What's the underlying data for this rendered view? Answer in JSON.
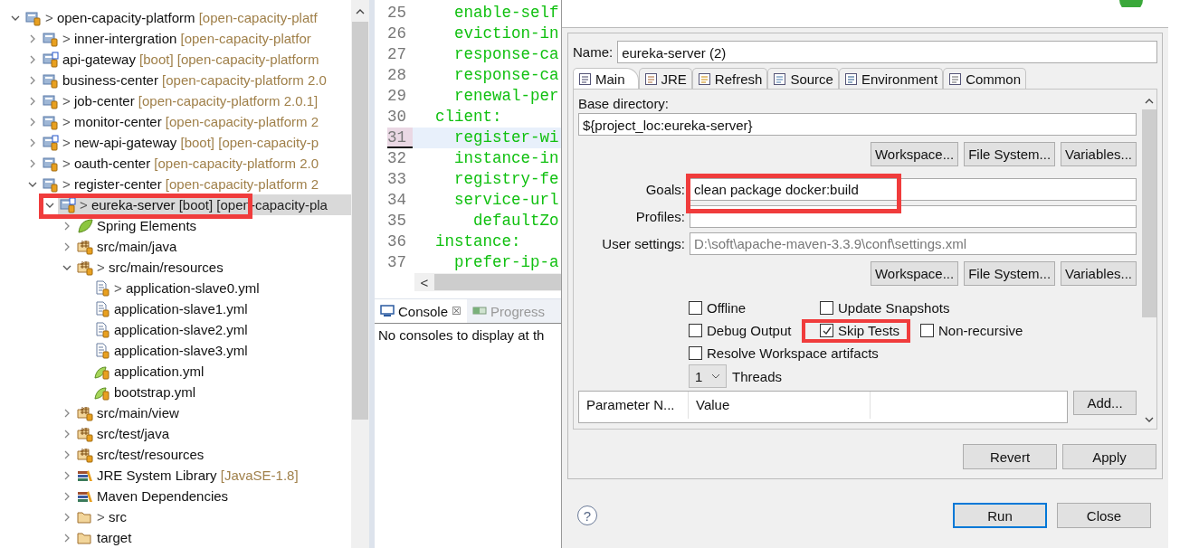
{
  "tree": {
    "items": [
      {
        "label": "open-capacity-platform",
        "prefix": ">",
        "detail": "[open-capacity-platf",
        "kind": "project",
        "expanded": true,
        "selected": false,
        "children": [
          {
            "label": "inner-intergration",
            "prefix": ">",
            "detail": "[open-capacity-platfor",
            "kind": "project",
            "expanded": false,
            "selected": false
          },
          {
            "label": "api-gateway",
            "detail": "[boot] [open-capacity-platform",
            "kind": "boot-project",
            "expanded": false,
            "selected": false
          },
          {
            "label": "business-center",
            "detail": "[open-capacity-platform 2.0",
            "kind": "project",
            "expanded": false,
            "selected": false
          },
          {
            "label": "job-center",
            "prefix": ">",
            "detail": "[open-capacity-platform 2.0.1]",
            "kind": "project",
            "expanded": false,
            "selected": false
          },
          {
            "label": "monitor-center",
            "prefix": ">",
            "detail": "[open-capacity-platform 2",
            "kind": "project",
            "expanded": false,
            "selected": false
          },
          {
            "label": "new-api-gateway",
            "prefix": ">",
            "detail": "[boot] [open-capacity-p",
            "kind": "boot-project",
            "expanded": false,
            "selected": false
          },
          {
            "label": "oauth-center",
            "prefix": ">",
            "detail": "[open-capacity-platform 2.0",
            "kind": "project",
            "expanded": false,
            "selected": false
          },
          {
            "label": "register-center",
            "prefix": ">",
            "detail": "[open-capacity-platform 2",
            "kind": "project",
            "expanded": true,
            "selected": false,
            "children": [
              {
                "label": "eureka-server",
                "prefix": ">",
                "detail": "[boot] [open-capacity-pla",
                "kind": "boot-project",
                "expanded": true,
                "selected": true,
                "children": [
                  {
                    "label": "Spring Elements",
                    "kind": "spring",
                    "expanded": false,
                    "selected": false
                  },
                  {
                    "label": "src/main/java",
                    "kind": "package-folder",
                    "expanded": false,
                    "selected": false
                  },
                  {
                    "label": "src/main/resources",
                    "prefix": ">",
                    "kind": "package-folder",
                    "expanded": true,
                    "selected": false,
                    "children": [
                      {
                        "label": "application-slave0.yml",
                        "prefix": ">",
                        "kind": "file",
                        "selected": false
                      },
                      {
                        "label": "application-slave1.yml",
                        "kind": "file",
                        "selected": false
                      },
                      {
                        "label": "application-slave2.yml",
                        "kind": "file",
                        "selected": false
                      },
                      {
                        "label": "application-slave3.yml",
                        "kind": "file",
                        "selected": false
                      },
                      {
                        "label": "application.yml",
                        "kind": "yml",
                        "selected": false
                      },
                      {
                        "label": "bootstrap.yml",
                        "kind": "yml",
                        "selected": false
                      }
                    ]
                  },
                  {
                    "label": "src/main/view",
                    "kind": "package-folder",
                    "expanded": false,
                    "selected": false
                  },
                  {
                    "label": "src/test/java",
                    "kind": "package-folder",
                    "expanded": false,
                    "selected": false
                  },
                  {
                    "label": "src/test/resources",
                    "kind": "package-folder",
                    "expanded": false,
                    "selected": false
                  },
                  {
                    "label": "JRE System Library",
                    "detail": "[JavaSE-1.8]",
                    "kind": "library",
                    "expanded": false,
                    "selected": false
                  },
                  {
                    "label": "Maven Dependencies",
                    "kind": "library",
                    "expanded": false,
                    "selected": false
                  },
                  {
                    "label": "src",
                    "prefix": ">",
                    "kind": "folder",
                    "expanded": false,
                    "selected": false
                  },
                  {
                    "label": "target",
                    "kind": "folder",
                    "expanded": false,
                    "selected": false
                  }
                ]
              }
            ]
          }
        ]
      }
    ]
  },
  "editor": {
    "lines": [
      {
        "number": "25",
        "code": "    enable-self",
        "current": false
      },
      {
        "number": "26",
        "code": "    eviction-in",
        "current": false
      },
      {
        "number": "27",
        "code": "    response-ca",
        "current": false
      },
      {
        "number": "28",
        "code": "    response-ca",
        "current": false
      },
      {
        "number": "29",
        "code": "    renewal-per",
        "current": false
      },
      {
        "number": "30",
        "code": "  client:",
        "current": false
      },
      {
        "number": "31",
        "code": "    register-wi",
        "current": true
      },
      {
        "number": "32",
        "code": "    instance-in",
        "current": false
      },
      {
        "number": "33",
        "code": "    registry-fe",
        "current": false
      },
      {
        "number": "34",
        "code": "    service-url",
        "current": false
      },
      {
        "number": "35",
        "code": "      defaultZo",
        "current": false
      },
      {
        "number": "36",
        "code": "  instance:",
        "current": false
      },
      {
        "number": "37",
        "code": "    prefer-ip-a",
        "current": false
      }
    ],
    "scroll_left": "<"
  },
  "console": {
    "tabs": [
      {
        "label": "Console",
        "close": "☒",
        "selected": true
      },
      {
        "label": "Progress",
        "selected": false
      }
    ],
    "message": "No consoles to display at th"
  },
  "dialog": {
    "name_label": "Name:",
    "name": "eureka-server (2)",
    "tabs": [
      {
        "label": "Main",
        "selected": true
      },
      {
        "label": "JRE",
        "selected": false
      },
      {
        "label": "Refresh",
        "selected": false
      },
      {
        "label": "Source",
        "selected": false
      },
      {
        "label": "Environment",
        "selected": false
      },
      {
        "label": "Common",
        "selected": false
      }
    ],
    "base_directory_label": "Base directory:",
    "base_directory": "${project_loc:eureka-server}",
    "dir_buttons": [
      "Workspace...",
      "File System...",
      "Variables..."
    ],
    "fields": [
      {
        "label": "Goals:",
        "value": "clean package docker:build"
      },
      {
        "label": "Profiles:"
      },
      {
        "label": "User settings:",
        "placeholder": "D:\\soft\\apache-maven-3.3.9\\conf\\settings.xml"
      }
    ],
    "settings_buttons": [
      "Workspace...",
      "File System...",
      "Variables..."
    ],
    "option_rows": [
      [
        {
          "label": "Offline",
          "checked": false
        },
        {
          "label": "Update Snapshots",
          "checked": false
        }
      ],
      [
        {
          "label": "Debug Output",
          "checked": false
        },
        {
          "label": "Skip Tests",
          "checked": true
        },
        {
          "label": "Non-recursive",
          "checked": false
        }
      ],
      [
        {
          "label": "Resolve Workspace artifacts",
          "checked": false
        }
      ]
    ],
    "threads": {
      "value": "1",
      "label": "Threads"
    },
    "parameters": {
      "columns": [
        "Parameter N...",
        "Value"
      ],
      "add": "Add..."
    },
    "actions": [
      "Revert",
      "Apply"
    ],
    "footer": [
      {
        "label": "Run",
        "default": true
      },
      {
        "label": "Close",
        "default": false
      }
    ],
    "help": "?"
  }
}
